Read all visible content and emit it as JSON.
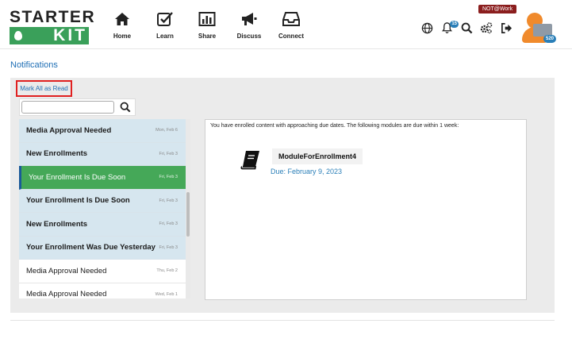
{
  "logo": {
    "line1": "STARTER",
    "line2": "KIT"
  },
  "nav": [
    {
      "label": "Home",
      "icon": "home-icon"
    },
    {
      "label": "Learn",
      "icon": "learn-icon"
    },
    {
      "label": "Share",
      "icon": "share-icon"
    },
    {
      "label": "Discuss",
      "icon": "megaphone-icon"
    },
    {
      "label": "Connect",
      "icon": "inbox-icon"
    }
  ],
  "utils": {
    "notification_count": "15",
    "not_at_work": "NOT@Work",
    "avatar_points": "520"
  },
  "page_title": "Notifications",
  "mark_all_label": "Mark All as Read",
  "search": {
    "placeholder": "",
    "value": ""
  },
  "notifications": [
    {
      "title": "Media Approval Needed",
      "date": "Mon, Feb 6",
      "state": "unread"
    },
    {
      "title": "New Enrollments",
      "date": "Fri, Feb 3",
      "state": "unread"
    },
    {
      "title": "Your Enrollment Is Due Soon",
      "date": "Fri, Feb 3",
      "state": "active"
    },
    {
      "title": "Your Enrollment Is Due Soon",
      "date": "Fri, Feb 3",
      "state": "unread"
    },
    {
      "title": "New Enrollments",
      "date": "Fri, Feb 3",
      "state": "unread"
    },
    {
      "title": "Your Enrollment Was Due Yesterday",
      "date": "Fri, Feb 3",
      "state": "unread"
    },
    {
      "title": "Media Approval Needed",
      "date": "Thu, Feb 2",
      "state": "read"
    },
    {
      "title": "Media Approval Needed",
      "date": "Wed, Feb 1",
      "state": "read"
    }
  ],
  "detail": {
    "message": "You have enrolled content with approaching due dates. The following modules are due within 1 week:",
    "module_name": "ModuleForEnrollment4",
    "due": "Due: February 9, 2023"
  },
  "colors": {
    "brand_green": "#3aa05a",
    "active_green": "#45a858",
    "link_blue": "#1f6fb5",
    "unread_bg": "#d6e6ef",
    "highlight_red": "#e02020"
  }
}
